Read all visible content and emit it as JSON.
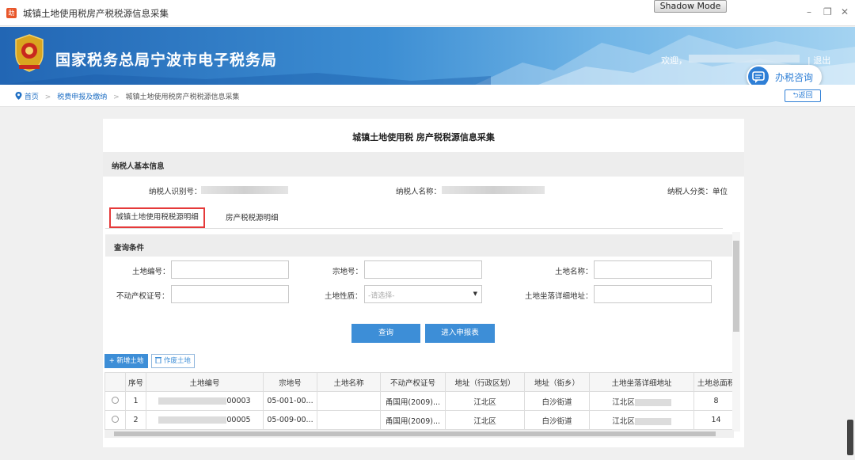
{
  "window": {
    "title": "城镇土地使用税房产税税源信息采集",
    "app_icon_glyph": "助",
    "shadow_mode": "Shadow Mode",
    "minimize": "–",
    "restore": "❐",
    "close": "✕"
  },
  "header": {
    "site_title": "国家税务总局宁波市电子税务局",
    "welcome": "欢迎，",
    "logout": "| 退出",
    "consult": "办税咨询"
  },
  "breadcrumb": {
    "items": [
      "首页",
      "税费申报及缴纳",
      "城镇土地使用税房产税税源信息采集"
    ],
    "separator": ">",
    "back": "返回"
  },
  "panel": {
    "title": "城镇土地使用税 房产税税源信息采集",
    "basic_section": "纳税人基本信息",
    "taxpayer_id_label": "纳税人识别号：",
    "taxpayer_name_label": "纳税人名称：",
    "taxpayer_type_label": "纳税人分类：",
    "taxpayer_type_value": "单位",
    "tabs": [
      "城镇土地使用税税源明细",
      "房产税税源明细"
    ],
    "query_section": "查询条件",
    "fields": {
      "land_no": "土地编号：",
      "parcel_no": "宗地号：",
      "land_name": "土地名称：",
      "property_cert": "不动产权证号：",
      "land_nature": "土地性质：",
      "land_nature_placeholder": "-请选择-",
      "land_address": "土地坐落详细地址："
    },
    "buttons": {
      "query": "查询",
      "enter_report": "进入申报表",
      "add_land": "+ 新增土地",
      "void_land": "作废土地"
    }
  },
  "table": {
    "headers": [
      "",
      "序号",
      "土地编号",
      "宗地号",
      "土地名称",
      "不动产权证号",
      "地址（行政区划）",
      "地址（街乡）",
      "土地坐落详细地址",
      "土地总面积"
    ],
    "rows": [
      {
        "no": "1",
        "land_no_suffix": "00003",
        "parcel": "05-001-00...",
        "name": "",
        "cert": "甬国用(2009)...",
        "district": "江北区",
        "street": "白沙街道",
        "address": "江北区",
        "area": "8"
      },
      {
        "no": "2",
        "land_no_suffix": "00005",
        "parcel": "05-009-00...",
        "name": "",
        "cert": "甬国用(2009)...",
        "district": "江北区",
        "street": "白沙街道",
        "address": "江北区",
        "area": "14"
      }
    ]
  },
  "colors": {
    "primary": "#3d8ed7",
    "tab_highlight": "#e53a3a",
    "banner": "#2266b4"
  },
  "icons": [
    "location-icon",
    "trash-icon",
    "chat-icon",
    "back-arrow-icon",
    "emblem-icon"
  ]
}
